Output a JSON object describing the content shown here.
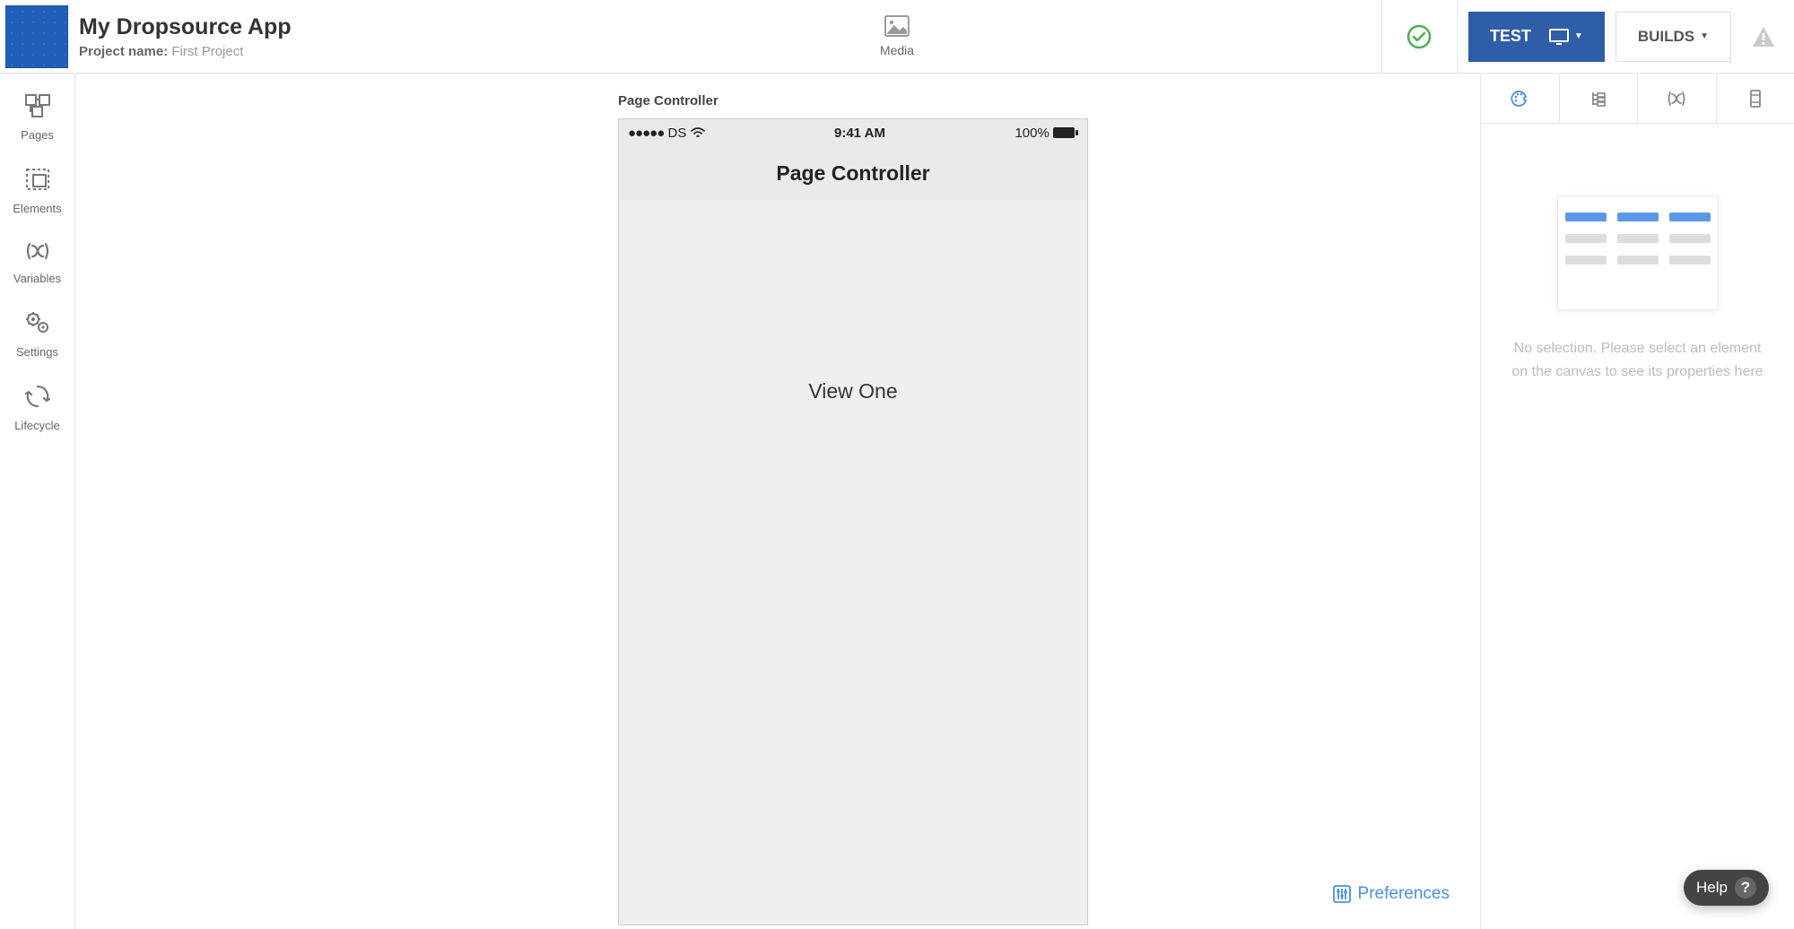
{
  "header": {
    "appTitle": "My Dropsource App",
    "projectLabel": "Project name:",
    "projectName": "First Project",
    "mediaLabel": "Media",
    "testLabel": "TEST",
    "buildsLabel": "BUILDS"
  },
  "leftbar": {
    "items": [
      {
        "label": "Pages"
      },
      {
        "label": "Elements"
      },
      {
        "label": "Variables"
      },
      {
        "label": "Settings"
      },
      {
        "label": "Lifecycle"
      }
    ]
  },
  "canvas": {
    "pageLabel": "Page Controller",
    "statusCarrier": "DS",
    "statusTime": "9:41 AM",
    "statusBattery": "100%",
    "navTitle": "Page Controller",
    "viewText": "View One",
    "preferences": "Preferences"
  },
  "inspector": {
    "emptyMessage": "No selection. Please select an element on the canvas to see its properties here"
  },
  "help": {
    "label": "Help",
    "icon": "?"
  }
}
